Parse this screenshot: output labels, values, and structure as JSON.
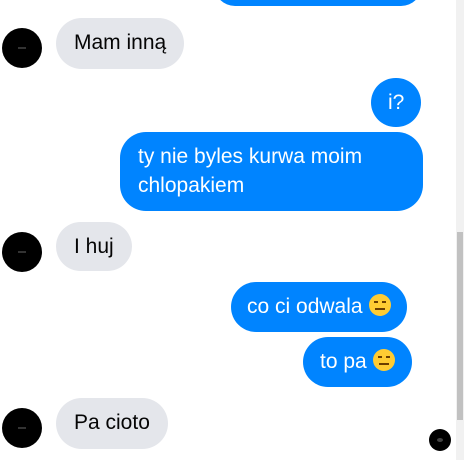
{
  "messages": [
    {
      "side": "in",
      "text": "Mam inną"
    },
    {
      "side": "out",
      "text": "i?"
    },
    {
      "side": "out",
      "line1": "ty nie byles kurwa moim",
      "line2": "chlopakiem"
    },
    {
      "side": "in",
      "text": "I huj"
    },
    {
      "side": "out",
      "text": "co ci odwala",
      "emoji": "expressionless-face"
    },
    {
      "side": "out",
      "text": "to pa",
      "emoji": "expressionless-face"
    },
    {
      "side": "in",
      "text": "Pa cioto"
    }
  ],
  "colors": {
    "outgoing_bubble": "#0084ff",
    "incoming_bubble": "#e4e6eb",
    "avatar": "#000000"
  }
}
